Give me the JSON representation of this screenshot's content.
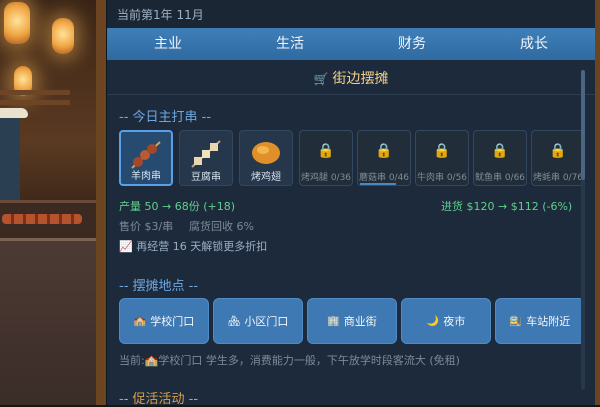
{
  "header": {
    "date_text": "当前第1年 11月"
  },
  "tabs": [
    "主业",
    "生活",
    "财务",
    "成长"
  ],
  "section": {
    "cart_icon": "shopping-cart-icon",
    "title": "街边摆摊"
  },
  "today_skewer": {
    "heading": "-- 今日主打串 --",
    "items": [
      {
        "name": "羊肉串",
        "selected": true,
        "locked": false
      },
      {
        "name": "豆腐串",
        "selected": false,
        "locked": false
      },
      {
        "name": "烤鸡翅",
        "selected": false,
        "locked": false
      },
      {
        "name": "烤鸡腿 0/36",
        "selected": false,
        "locked": true,
        "progress": 0.0
      },
      {
        "name": "蘑菇串 0/46",
        "selected": false,
        "locked": true,
        "progress": 0.7
      },
      {
        "name": "牛肉串 0/56",
        "selected": false,
        "locked": true,
        "progress": 0.0
      },
      {
        "name": "鱿鱼串 0/66",
        "selected": false,
        "locked": true,
        "progress": 0.0
      },
      {
        "name": "烤蚝串 0/76",
        "selected": false,
        "locked": true,
        "progress": 0.0
      }
    ],
    "output_text": "产量 50 → 68份 (+18)",
    "income_text": "进货 $120 → $112 (-6%)",
    "price_text": "售价 $3/串",
    "rot_text": "腐货回收 6%",
    "tip_text": "再经营 16 天解锁更多折扣"
  },
  "locations": {
    "heading": "-- 摆摊地点 --",
    "items": [
      {
        "icon": "school-icon",
        "label": "学校门口"
      },
      {
        "icon": "community-icon",
        "label": "小区门口"
      },
      {
        "icon": "business-icon",
        "label": "商业街"
      },
      {
        "icon": "moon-icon",
        "label": "夜市"
      },
      {
        "icon": "station-icon",
        "label": "车站附近"
      }
    ],
    "current_text": "当前:🏫学校门口  学生多，消费能力一般，下午放学时段客流大 (免租)"
  },
  "promo": {
    "heading": "-- 促活活动 --"
  }
}
